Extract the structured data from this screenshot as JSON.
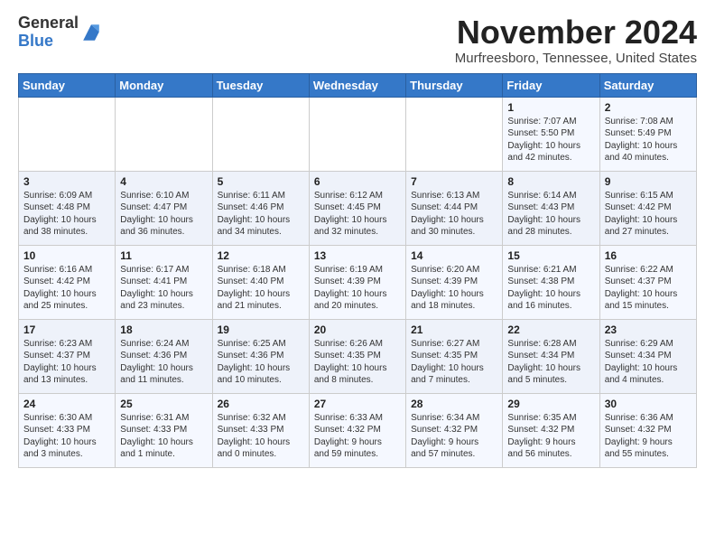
{
  "logo": {
    "general": "General",
    "blue": "Blue"
  },
  "header": {
    "month": "November 2024",
    "location": "Murfreesboro, Tennessee, United States"
  },
  "weekdays": [
    "Sunday",
    "Monday",
    "Tuesday",
    "Wednesday",
    "Thursday",
    "Friday",
    "Saturday"
  ],
  "weeks": [
    [
      {
        "day": "",
        "info": ""
      },
      {
        "day": "",
        "info": ""
      },
      {
        "day": "",
        "info": ""
      },
      {
        "day": "",
        "info": ""
      },
      {
        "day": "",
        "info": ""
      },
      {
        "day": "1",
        "info": "Sunrise: 7:07 AM\nSunset: 5:50 PM\nDaylight: 10 hours\nand 42 minutes."
      },
      {
        "day": "2",
        "info": "Sunrise: 7:08 AM\nSunset: 5:49 PM\nDaylight: 10 hours\nand 40 minutes."
      }
    ],
    [
      {
        "day": "3",
        "info": "Sunrise: 6:09 AM\nSunset: 4:48 PM\nDaylight: 10 hours\nand 38 minutes."
      },
      {
        "day": "4",
        "info": "Sunrise: 6:10 AM\nSunset: 4:47 PM\nDaylight: 10 hours\nand 36 minutes."
      },
      {
        "day": "5",
        "info": "Sunrise: 6:11 AM\nSunset: 4:46 PM\nDaylight: 10 hours\nand 34 minutes."
      },
      {
        "day": "6",
        "info": "Sunrise: 6:12 AM\nSunset: 4:45 PM\nDaylight: 10 hours\nand 32 minutes."
      },
      {
        "day": "7",
        "info": "Sunrise: 6:13 AM\nSunset: 4:44 PM\nDaylight: 10 hours\nand 30 minutes."
      },
      {
        "day": "8",
        "info": "Sunrise: 6:14 AM\nSunset: 4:43 PM\nDaylight: 10 hours\nand 28 minutes."
      },
      {
        "day": "9",
        "info": "Sunrise: 6:15 AM\nSunset: 4:42 PM\nDaylight: 10 hours\nand 27 minutes."
      }
    ],
    [
      {
        "day": "10",
        "info": "Sunrise: 6:16 AM\nSunset: 4:42 PM\nDaylight: 10 hours\nand 25 minutes."
      },
      {
        "day": "11",
        "info": "Sunrise: 6:17 AM\nSunset: 4:41 PM\nDaylight: 10 hours\nand 23 minutes."
      },
      {
        "day": "12",
        "info": "Sunrise: 6:18 AM\nSunset: 4:40 PM\nDaylight: 10 hours\nand 21 minutes."
      },
      {
        "day": "13",
        "info": "Sunrise: 6:19 AM\nSunset: 4:39 PM\nDaylight: 10 hours\nand 20 minutes."
      },
      {
        "day": "14",
        "info": "Sunrise: 6:20 AM\nSunset: 4:39 PM\nDaylight: 10 hours\nand 18 minutes."
      },
      {
        "day": "15",
        "info": "Sunrise: 6:21 AM\nSunset: 4:38 PM\nDaylight: 10 hours\nand 16 minutes."
      },
      {
        "day": "16",
        "info": "Sunrise: 6:22 AM\nSunset: 4:37 PM\nDaylight: 10 hours\nand 15 minutes."
      }
    ],
    [
      {
        "day": "17",
        "info": "Sunrise: 6:23 AM\nSunset: 4:37 PM\nDaylight: 10 hours\nand 13 minutes."
      },
      {
        "day": "18",
        "info": "Sunrise: 6:24 AM\nSunset: 4:36 PM\nDaylight: 10 hours\nand 11 minutes."
      },
      {
        "day": "19",
        "info": "Sunrise: 6:25 AM\nSunset: 4:36 PM\nDaylight: 10 hours\nand 10 minutes."
      },
      {
        "day": "20",
        "info": "Sunrise: 6:26 AM\nSunset: 4:35 PM\nDaylight: 10 hours\nand 8 minutes."
      },
      {
        "day": "21",
        "info": "Sunrise: 6:27 AM\nSunset: 4:35 PM\nDaylight: 10 hours\nand 7 minutes."
      },
      {
        "day": "22",
        "info": "Sunrise: 6:28 AM\nSunset: 4:34 PM\nDaylight: 10 hours\nand 5 minutes."
      },
      {
        "day": "23",
        "info": "Sunrise: 6:29 AM\nSunset: 4:34 PM\nDaylight: 10 hours\nand 4 minutes."
      }
    ],
    [
      {
        "day": "24",
        "info": "Sunrise: 6:30 AM\nSunset: 4:33 PM\nDaylight: 10 hours\nand 3 minutes."
      },
      {
        "day": "25",
        "info": "Sunrise: 6:31 AM\nSunset: 4:33 PM\nDaylight: 10 hours\nand 1 minute."
      },
      {
        "day": "26",
        "info": "Sunrise: 6:32 AM\nSunset: 4:33 PM\nDaylight: 10 hours\nand 0 minutes."
      },
      {
        "day": "27",
        "info": "Sunrise: 6:33 AM\nSunset: 4:32 PM\nDaylight: 9 hours\nand 59 minutes."
      },
      {
        "day": "28",
        "info": "Sunrise: 6:34 AM\nSunset: 4:32 PM\nDaylight: 9 hours\nand 57 minutes."
      },
      {
        "day": "29",
        "info": "Sunrise: 6:35 AM\nSunset: 4:32 PM\nDaylight: 9 hours\nand 56 minutes."
      },
      {
        "day": "30",
        "info": "Sunrise: 6:36 AM\nSunset: 4:32 PM\nDaylight: 9 hours\nand 55 minutes."
      }
    ]
  ]
}
